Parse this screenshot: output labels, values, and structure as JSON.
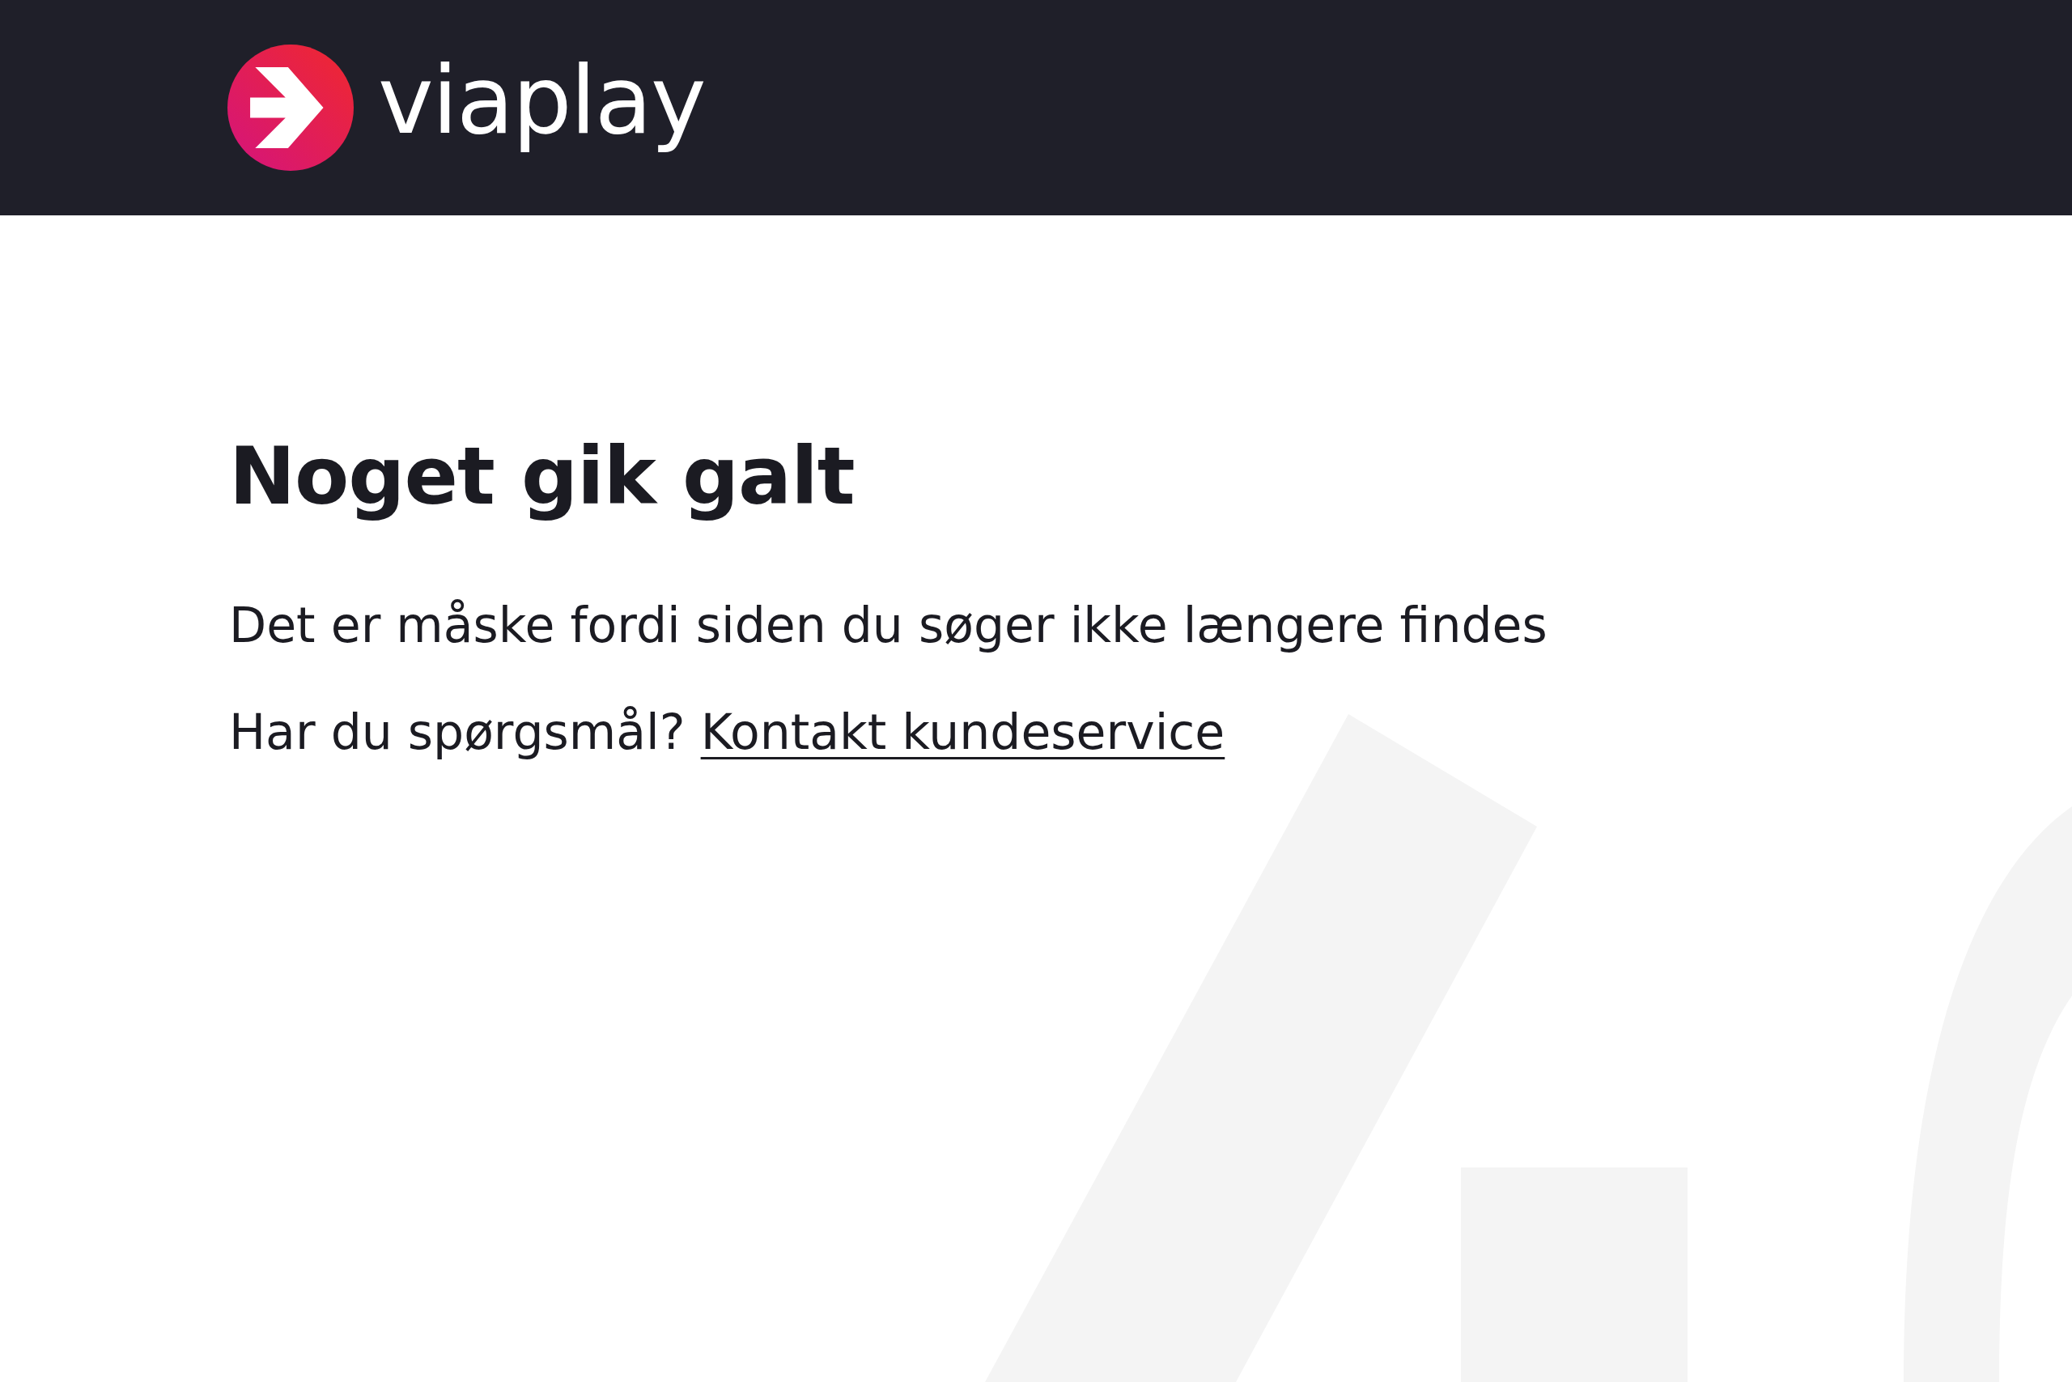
{
  "header": {
    "logo_text": "viaplay"
  },
  "error": {
    "title": "Noget gik galt",
    "message": "Det er måske fordi siden du søger ikke længere findes",
    "help_text": "Har du spørgsmål?",
    "link": "Kontakt kundeservice"
  }
}
